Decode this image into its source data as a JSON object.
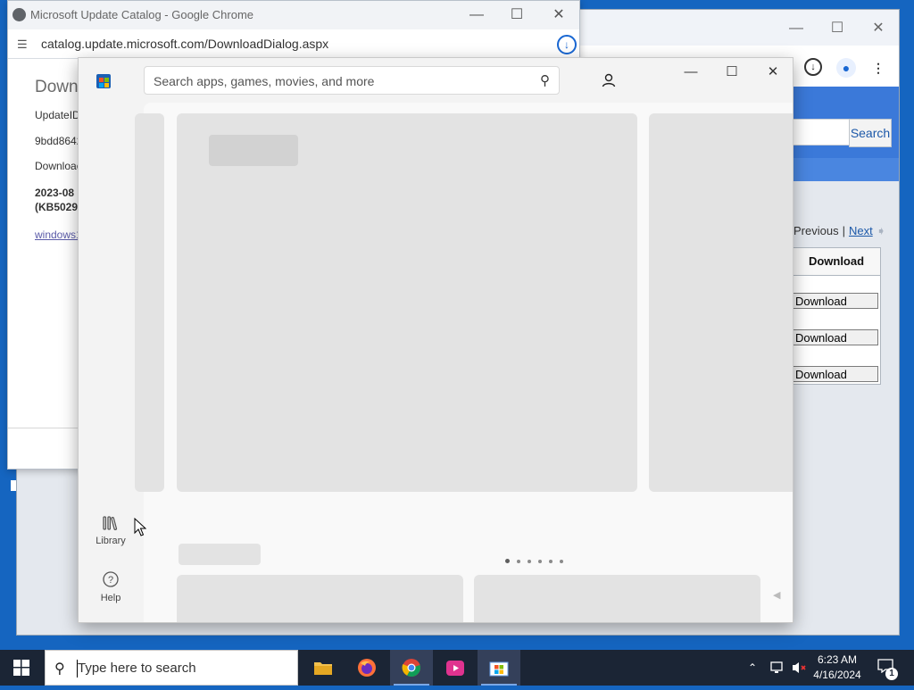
{
  "back_window": {
    "search_button": "Search",
    "pager": {
      "previous": "Previous",
      "separator": "|",
      "next": "Next"
    },
    "table": {
      "header": "Download",
      "buttons": [
        "Download",
        "Download",
        "Download"
      ]
    }
  },
  "dialog_window": {
    "title": "Microsoft Update Catalog - Google Chrome",
    "url": "catalog.update.microsoft.com/DownloadDialog.aspx",
    "heading": "Down",
    "lines": [
      "UpdateID",
      "9bdd8642",
      "Downloac"
    ],
    "bold_lines": [
      "2023-08",
      "(KB5029"
    ],
    "link": "windows1"
  },
  "store": {
    "search_placeholder": "Search apps, games, movies, and more",
    "library_label": "Library",
    "help_label": "Help",
    "carousel_dots": 6,
    "carousel_active": 0
  },
  "taskbar": {
    "search_placeholder": "Type here to search",
    "time": "6:23 AM",
    "date": "4/16/2024",
    "notification_count": "1"
  },
  "colors": {
    "desktop": "#1565c0",
    "taskbar": "#1b2535",
    "accent": "#1c58a8"
  }
}
